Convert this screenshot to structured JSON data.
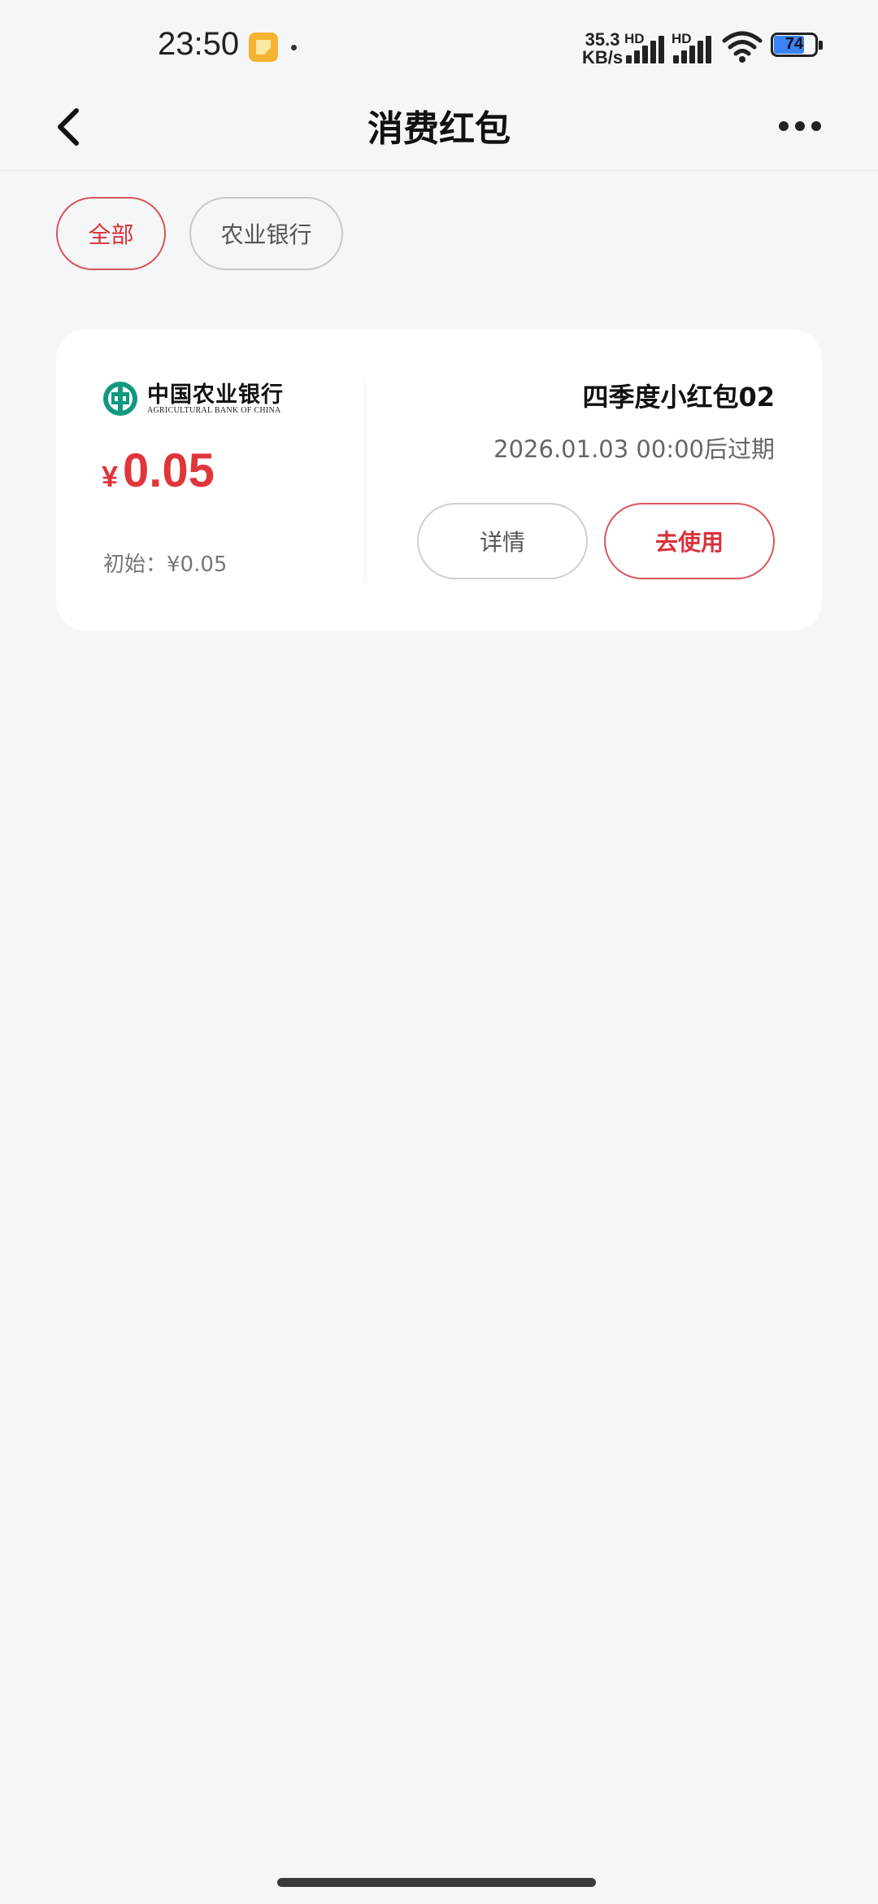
{
  "status_bar": {
    "time": "23:50",
    "net_speed_value": "35.3",
    "net_speed_unit": "KB/s",
    "sim1_label": "HD",
    "sim2_label": "HD",
    "battery_level": "74",
    "battery_fraction": 0.74
  },
  "header": {
    "title": "消费红包"
  },
  "filters": {
    "all_label": "全部",
    "bank_label": "农业银行",
    "selected": "全部"
  },
  "coupon": {
    "bank_name": "中国农业银行",
    "bank_name_en": "AGRICULTURAL BANK OF CHINA",
    "currency_symbol": "¥",
    "amount": "0.05",
    "initial_amount": "初始：¥0.05",
    "title": "四季度小红包02",
    "expiry": "2026.01.03 00:00后过期",
    "detail_label": "详情",
    "use_label": "去使用"
  },
  "colors": {
    "accent_red": "#e0363b",
    "logo_green": "#0f9a80",
    "background": "#f5f6f8"
  }
}
